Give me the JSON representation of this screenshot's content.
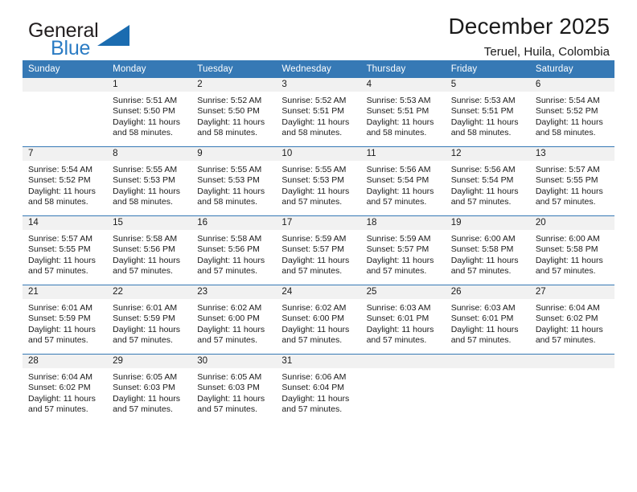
{
  "brand": {
    "name_part1": "General",
    "name_part2": "Blue",
    "logo_icon": "triangle-logo-icon",
    "blue": "#2b7cc4"
  },
  "header": {
    "title": "December 2025",
    "subtitle": "Teruel, Huila, Colombia"
  },
  "theme": {
    "header_blue": "#3679b5",
    "daynum_gray": "#f1f1f1"
  },
  "weekdays": [
    "Sunday",
    "Monday",
    "Tuesday",
    "Wednesday",
    "Thursday",
    "Friday",
    "Saturday"
  ],
  "weeks": [
    [
      {
        "day": "",
        "lines": []
      },
      {
        "day": "1",
        "lines": [
          "Sunrise: 5:51 AM",
          "Sunset: 5:50 PM",
          "Daylight: 11 hours",
          "and 58 minutes."
        ]
      },
      {
        "day": "2",
        "lines": [
          "Sunrise: 5:52 AM",
          "Sunset: 5:50 PM",
          "Daylight: 11 hours",
          "and 58 minutes."
        ]
      },
      {
        "day": "3",
        "lines": [
          "Sunrise: 5:52 AM",
          "Sunset: 5:51 PM",
          "Daylight: 11 hours",
          "and 58 minutes."
        ]
      },
      {
        "day": "4",
        "lines": [
          "Sunrise: 5:53 AM",
          "Sunset: 5:51 PM",
          "Daylight: 11 hours",
          "and 58 minutes."
        ]
      },
      {
        "day": "5",
        "lines": [
          "Sunrise: 5:53 AM",
          "Sunset: 5:51 PM",
          "Daylight: 11 hours",
          "and 58 minutes."
        ]
      },
      {
        "day": "6",
        "lines": [
          "Sunrise: 5:54 AM",
          "Sunset: 5:52 PM",
          "Daylight: 11 hours",
          "and 58 minutes."
        ]
      }
    ],
    [
      {
        "day": "7",
        "lines": [
          "Sunrise: 5:54 AM",
          "Sunset: 5:52 PM",
          "Daylight: 11 hours",
          "and 58 minutes."
        ]
      },
      {
        "day": "8",
        "lines": [
          "Sunrise: 5:55 AM",
          "Sunset: 5:53 PM",
          "Daylight: 11 hours",
          "and 58 minutes."
        ]
      },
      {
        "day": "9",
        "lines": [
          "Sunrise: 5:55 AM",
          "Sunset: 5:53 PM",
          "Daylight: 11 hours",
          "and 58 minutes."
        ]
      },
      {
        "day": "10",
        "lines": [
          "Sunrise: 5:55 AM",
          "Sunset: 5:53 PM",
          "Daylight: 11 hours",
          "and 57 minutes."
        ]
      },
      {
        "day": "11",
        "lines": [
          "Sunrise: 5:56 AM",
          "Sunset: 5:54 PM",
          "Daylight: 11 hours",
          "and 57 minutes."
        ]
      },
      {
        "day": "12",
        "lines": [
          "Sunrise: 5:56 AM",
          "Sunset: 5:54 PM",
          "Daylight: 11 hours",
          "and 57 minutes."
        ]
      },
      {
        "day": "13",
        "lines": [
          "Sunrise: 5:57 AM",
          "Sunset: 5:55 PM",
          "Daylight: 11 hours",
          "and 57 minutes."
        ]
      }
    ],
    [
      {
        "day": "14",
        "lines": [
          "Sunrise: 5:57 AM",
          "Sunset: 5:55 PM",
          "Daylight: 11 hours",
          "and 57 minutes."
        ]
      },
      {
        "day": "15",
        "lines": [
          "Sunrise: 5:58 AM",
          "Sunset: 5:56 PM",
          "Daylight: 11 hours",
          "and 57 minutes."
        ]
      },
      {
        "day": "16",
        "lines": [
          "Sunrise: 5:58 AM",
          "Sunset: 5:56 PM",
          "Daylight: 11 hours",
          "and 57 minutes."
        ]
      },
      {
        "day": "17",
        "lines": [
          "Sunrise: 5:59 AM",
          "Sunset: 5:57 PM",
          "Daylight: 11 hours",
          "and 57 minutes."
        ]
      },
      {
        "day": "18",
        "lines": [
          "Sunrise: 5:59 AM",
          "Sunset: 5:57 PM",
          "Daylight: 11 hours",
          "and 57 minutes."
        ]
      },
      {
        "day": "19",
        "lines": [
          "Sunrise: 6:00 AM",
          "Sunset: 5:58 PM",
          "Daylight: 11 hours",
          "and 57 minutes."
        ]
      },
      {
        "day": "20",
        "lines": [
          "Sunrise: 6:00 AM",
          "Sunset: 5:58 PM",
          "Daylight: 11 hours",
          "and 57 minutes."
        ]
      }
    ],
    [
      {
        "day": "21",
        "lines": [
          "Sunrise: 6:01 AM",
          "Sunset: 5:59 PM",
          "Daylight: 11 hours",
          "and 57 minutes."
        ]
      },
      {
        "day": "22",
        "lines": [
          "Sunrise: 6:01 AM",
          "Sunset: 5:59 PM",
          "Daylight: 11 hours",
          "and 57 minutes."
        ]
      },
      {
        "day": "23",
        "lines": [
          "Sunrise: 6:02 AM",
          "Sunset: 6:00 PM",
          "Daylight: 11 hours",
          "and 57 minutes."
        ]
      },
      {
        "day": "24",
        "lines": [
          "Sunrise: 6:02 AM",
          "Sunset: 6:00 PM",
          "Daylight: 11 hours",
          "and 57 minutes."
        ]
      },
      {
        "day": "25",
        "lines": [
          "Sunrise: 6:03 AM",
          "Sunset: 6:01 PM",
          "Daylight: 11 hours",
          "and 57 minutes."
        ]
      },
      {
        "day": "26",
        "lines": [
          "Sunrise: 6:03 AM",
          "Sunset: 6:01 PM",
          "Daylight: 11 hours",
          "and 57 minutes."
        ]
      },
      {
        "day": "27",
        "lines": [
          "Sunrise: 6:04 AM",
          "Sunset: 6:02 PM",
          "Daylight: 11 hours",
          "and 57 minutes."
        ]
      }
    ],
    [
      {
        "day": "28",
        "lines": [
          "Sunrise: 6:04 AM",
          "Sunset: 6:02 PM",
          "Daylight: 11 hours",
          "and 57 minutes."
        ]
      },
      {
        "day": "29",
        "lines": [
          "Sunrise: 6:05 AM",
          "Sunset: 6:03 PM",
          "Daylight: 11 hours",
          "and 57 minutes."
        ]
      },
      {
        "day": "30",
        "lines": [
          "Sunrise: 6:05 AM",
          "Sunset: 6:03 PM",
          "Daylight: 11 hours",
          "and 57 minutes."
        ]
      },
      {
        "day": "31",
        "lines": [
          "Sunrise: 6:06 AM",
          "Sunset: 6:04 PM",
          "Daylight: 11 hours",
          "and 57 minutes."
        ]
      },
      {
        "day": "",
        "lines": []
      },
      {
        "day": "",
        "lines": []
      },
      {
        "day": "",
        "lines": []
      }
    ]
  ]
}
